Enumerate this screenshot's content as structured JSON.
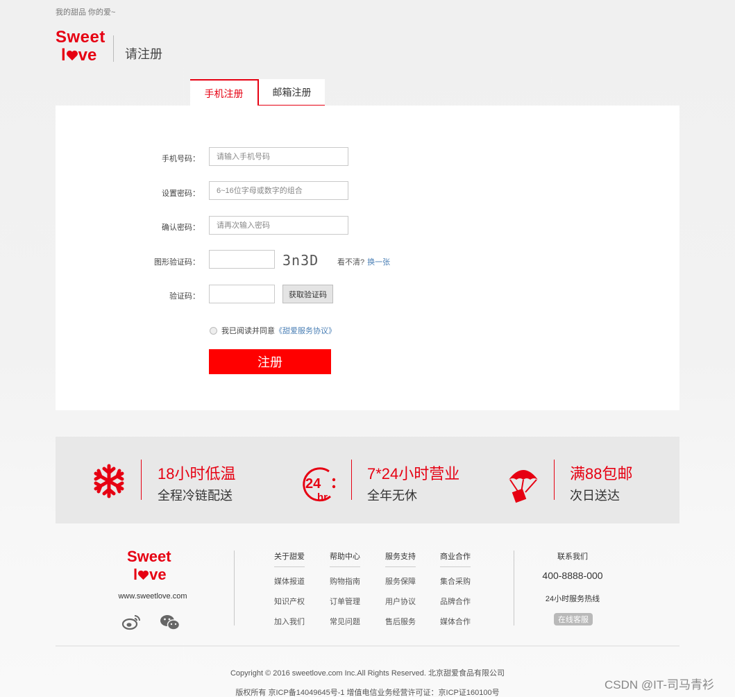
{
  "topbar": {
    "slogan": "我的甜品 你的爱~"
  },
  "logo": {
    "line1": "Sweet",
    "line2_l": "l",
    "line2_rest": "ve"
  },
  "header": {
    "title": "请注册"
  },
  "tabs": [
    {
      "label": "手机注册",
      "active": true
    },
    {
      "label": "邮箱注册",
      "active": false
    }
  ],
  "form": {
    "phone": {
      "label": "手机号码：",
      "placeholder": "请输入手机号码"
    },
    "password": {
      "label": "设置密码：",
      "placeholder": "6~16位字母或数字的组合"
    },
    "confirm": {
      "label": "确认密码：",
      "placeholder": "请再次输入密码"
    },
    "captcha": {
      "label": "图形验证码：",
      "image_text": "3n3D",
      "hint": "看不清?",
      "refresh": "换一张"
    },
    "sms": {
      "label": "验证码：",
      "button": "获取验证码"
    },
    "agreement": {
      "text": "我已阅读并同意",
      "link": "《甜爱服务协议》"
    },
    "submit": "注册"
  },
  "features": [
    {
      "title": "18小时低温",
      "subtitle": "全程冷链配送",
      "icon": "snowflake-icon"
    },
    {
      "title": "7*24小时营业",
      "subtitle": "全年无休",
      "icon": "24hr-icon"
    },
    {
      "title": "满88包邮",
      "subtitle": "次日送达",
      "icon": "parachute-box-icon"
    }
  ],
  "footer": {
    "logo_line1": "Sweet",
    "url": "www.sweetlove.com",
    "columns": [
      {
        "head": "关于甜爱",
        "items": [
          "媒体报道",
          "知识产权",
          "加入我们"
        ]
      },
      {
        "head": "帮助中心",
        "items": [
          "购物指南",
          "订单管理",
          "常见问题"
        ]
      },
      {
        "head": "服务支持",
        "items": [
          "服务保障",
          "用户协议",
          "售后服务"
        ]
      },
      {
        "head": "商业合作",
        "items": [
          "集合采购",
          "品牌合作",
          "媒体合作"
        ]
      }
    ],
    "contact": {
      "head": "联系我们",
      "phone": "400-8888-000",
      "hotline": "24小时服务热线",
      "button": "在线客服"
    },
    "copyright": "Copyright © 2016 sweetlove.com Inc.All Rights Reserved. 北京甜爱食品有限公司",
    "icp": "版权所有 京ICP备14049645号-1 增值电信业务经营许可证：京ICP证160100号"
  },
  "watermark": "CSDN @IT-司马青衫",
  "colors": {
    "brand": "#e60012",
    "submit": "#ff0000",
    "link": "#4a7fb5"
  }
}
